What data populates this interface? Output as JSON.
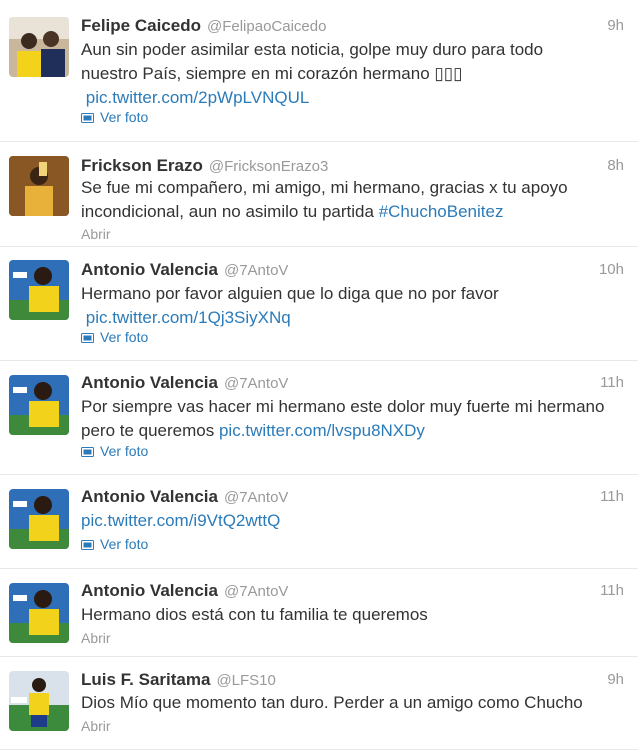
{
  "colors": {
    "link": "#2b7bb9",
    "name": "#333333",
    "muted": "#999999",
    "divider": "#e8e8e8"
  },
  "tweets": [
    {
      "name": "Felipe Caicedo",
      "handle": "@FelipaoCaicedo",
      "time": "9h",
      "text_lines": [
        "Aun sin poder asimilar esta noticia, golpe muy duro para todo",
        "nuestro País, siempre en mi corazón hermano ▯▯▯"
      ],
      "link": "pic.twitter.com/2pWpLVNQUL",
      "action": "Ver foto",
      "action_icon": "photo-icon"
    },
    {
      "name": "Frickson Erazo",
      "handle": "@FricksonErazo3",
      "time": "8h",
      "text_lines": [
        "Se fue mi compañero, mi amigo, mi hermano, gracias x tu apoyo",
        "incondicional, aun no asimilo tu partida "
      ],
      "link": "#ChuchoBenitez",
      "action": "Abrir"
    },
    {
      "name": "Antonio Valencia",
      "handle": "@7AntoV",
      "time": "10h",
      "text_lines": [
        "Hermano por favor alguien que lo diga que no por favor"
      ],
      "link": "pic.twitter.com/1Qj3SiyXNq",
      "action": "Ver foto",
      "action_icon": "photo-icon"
    },
    {
      "name": "Antonio Valencia",
      "handle": "@7AntoV",
      "time": "11h",
      "text_lines": [
        "Por siempre vas hacer mi hermano este dolor muy fuerte mi hermano",
        "pero te queremos "
      ],
      "link": "pic.twitter.com/lvspu8NXDy",
      "action": "Ver foto",
      "action_icon": "photo-icon"
    },
    {
      "name": "Antonio Valencia",
      "handle": "@7AntoV",
      "time": "11h",
      "text_lines": [],
      "link": "pic.twitter.com/i9VtQ2wttQ",
      "action": "Ver foto",
      "action_icon": "photo-icon"
    },
    {
      "name": "Antonio Valencia",
      "handle": "@7AntoV",
      "time": "11h",
      "text_lines": [
        "Hermano dios  está con tu familia te queremos"
      ],
      "link": "",
      "action": "Abrir"
    },
    {
      "name": "Luis F. Saritama",
      "handle": "@LFS10",
      "time": "9h",
      "text_lines": [
        "Dios Mío que momento tan duro. Perder a un amigo como Chucho"
      ],
      "link": "",
      "action": "Abrir"
    }
  ]
}
